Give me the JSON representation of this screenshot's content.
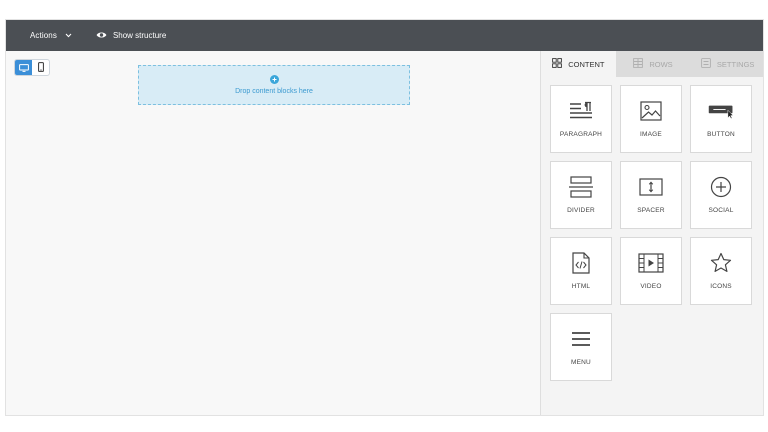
{
  "topbar": {
    "actions_label": "Actions",
    "show_structure_label": "Show structure"
  },
  "canvas": {
    "drop_zone_text": "Drop content blocks here"
  },
  "sidebar": {
    "tabs": [
      {
        "label": "CONTENT",
        "icon": "grid-icon",
        "active": true
      },
      {
        "label": "ROWS",
        "icon": "rows-icon",
        "active": false
      },
      {
        "label": "SETTINGS",
        "icon": "settings-icon",
        "active": false
      }
    ],
    "blocks": [
      {
        "label": "PARAGRAPH",
        "icon": "paragraph-icon"
      },
      {
        "label": "IMAGE",
        "icon": "image-icon"
      },
      {
        "label": "BUTTON",
        "icon": "button-icon"
      },
      {
        "label": "DIVIDER",
        "icon": "divider-icon"
      },
      {
        "label": "SPACER",
        "icon": "spacer-icon"
      },
      {
        "label": "SOCIAL",
        "icon": "social-icon"
      },
      {
        "label": "HTML",
        "icon": "html-icon"
      },
      {
        "label": "VIDEO",
        "icon": "video-icon"
      },
      {
        "label": "ICONS",
        "icon": "star-icon"
      },
      {
        "label": "MENU",
        "icon": "menu-icon"
      }
    ]
  },
  "colors": {
    "topbar": "#4b4f54",
    "accent": "#3aa6da",
    "drop_zone_bg": "#d8ecf6"
  }
}
